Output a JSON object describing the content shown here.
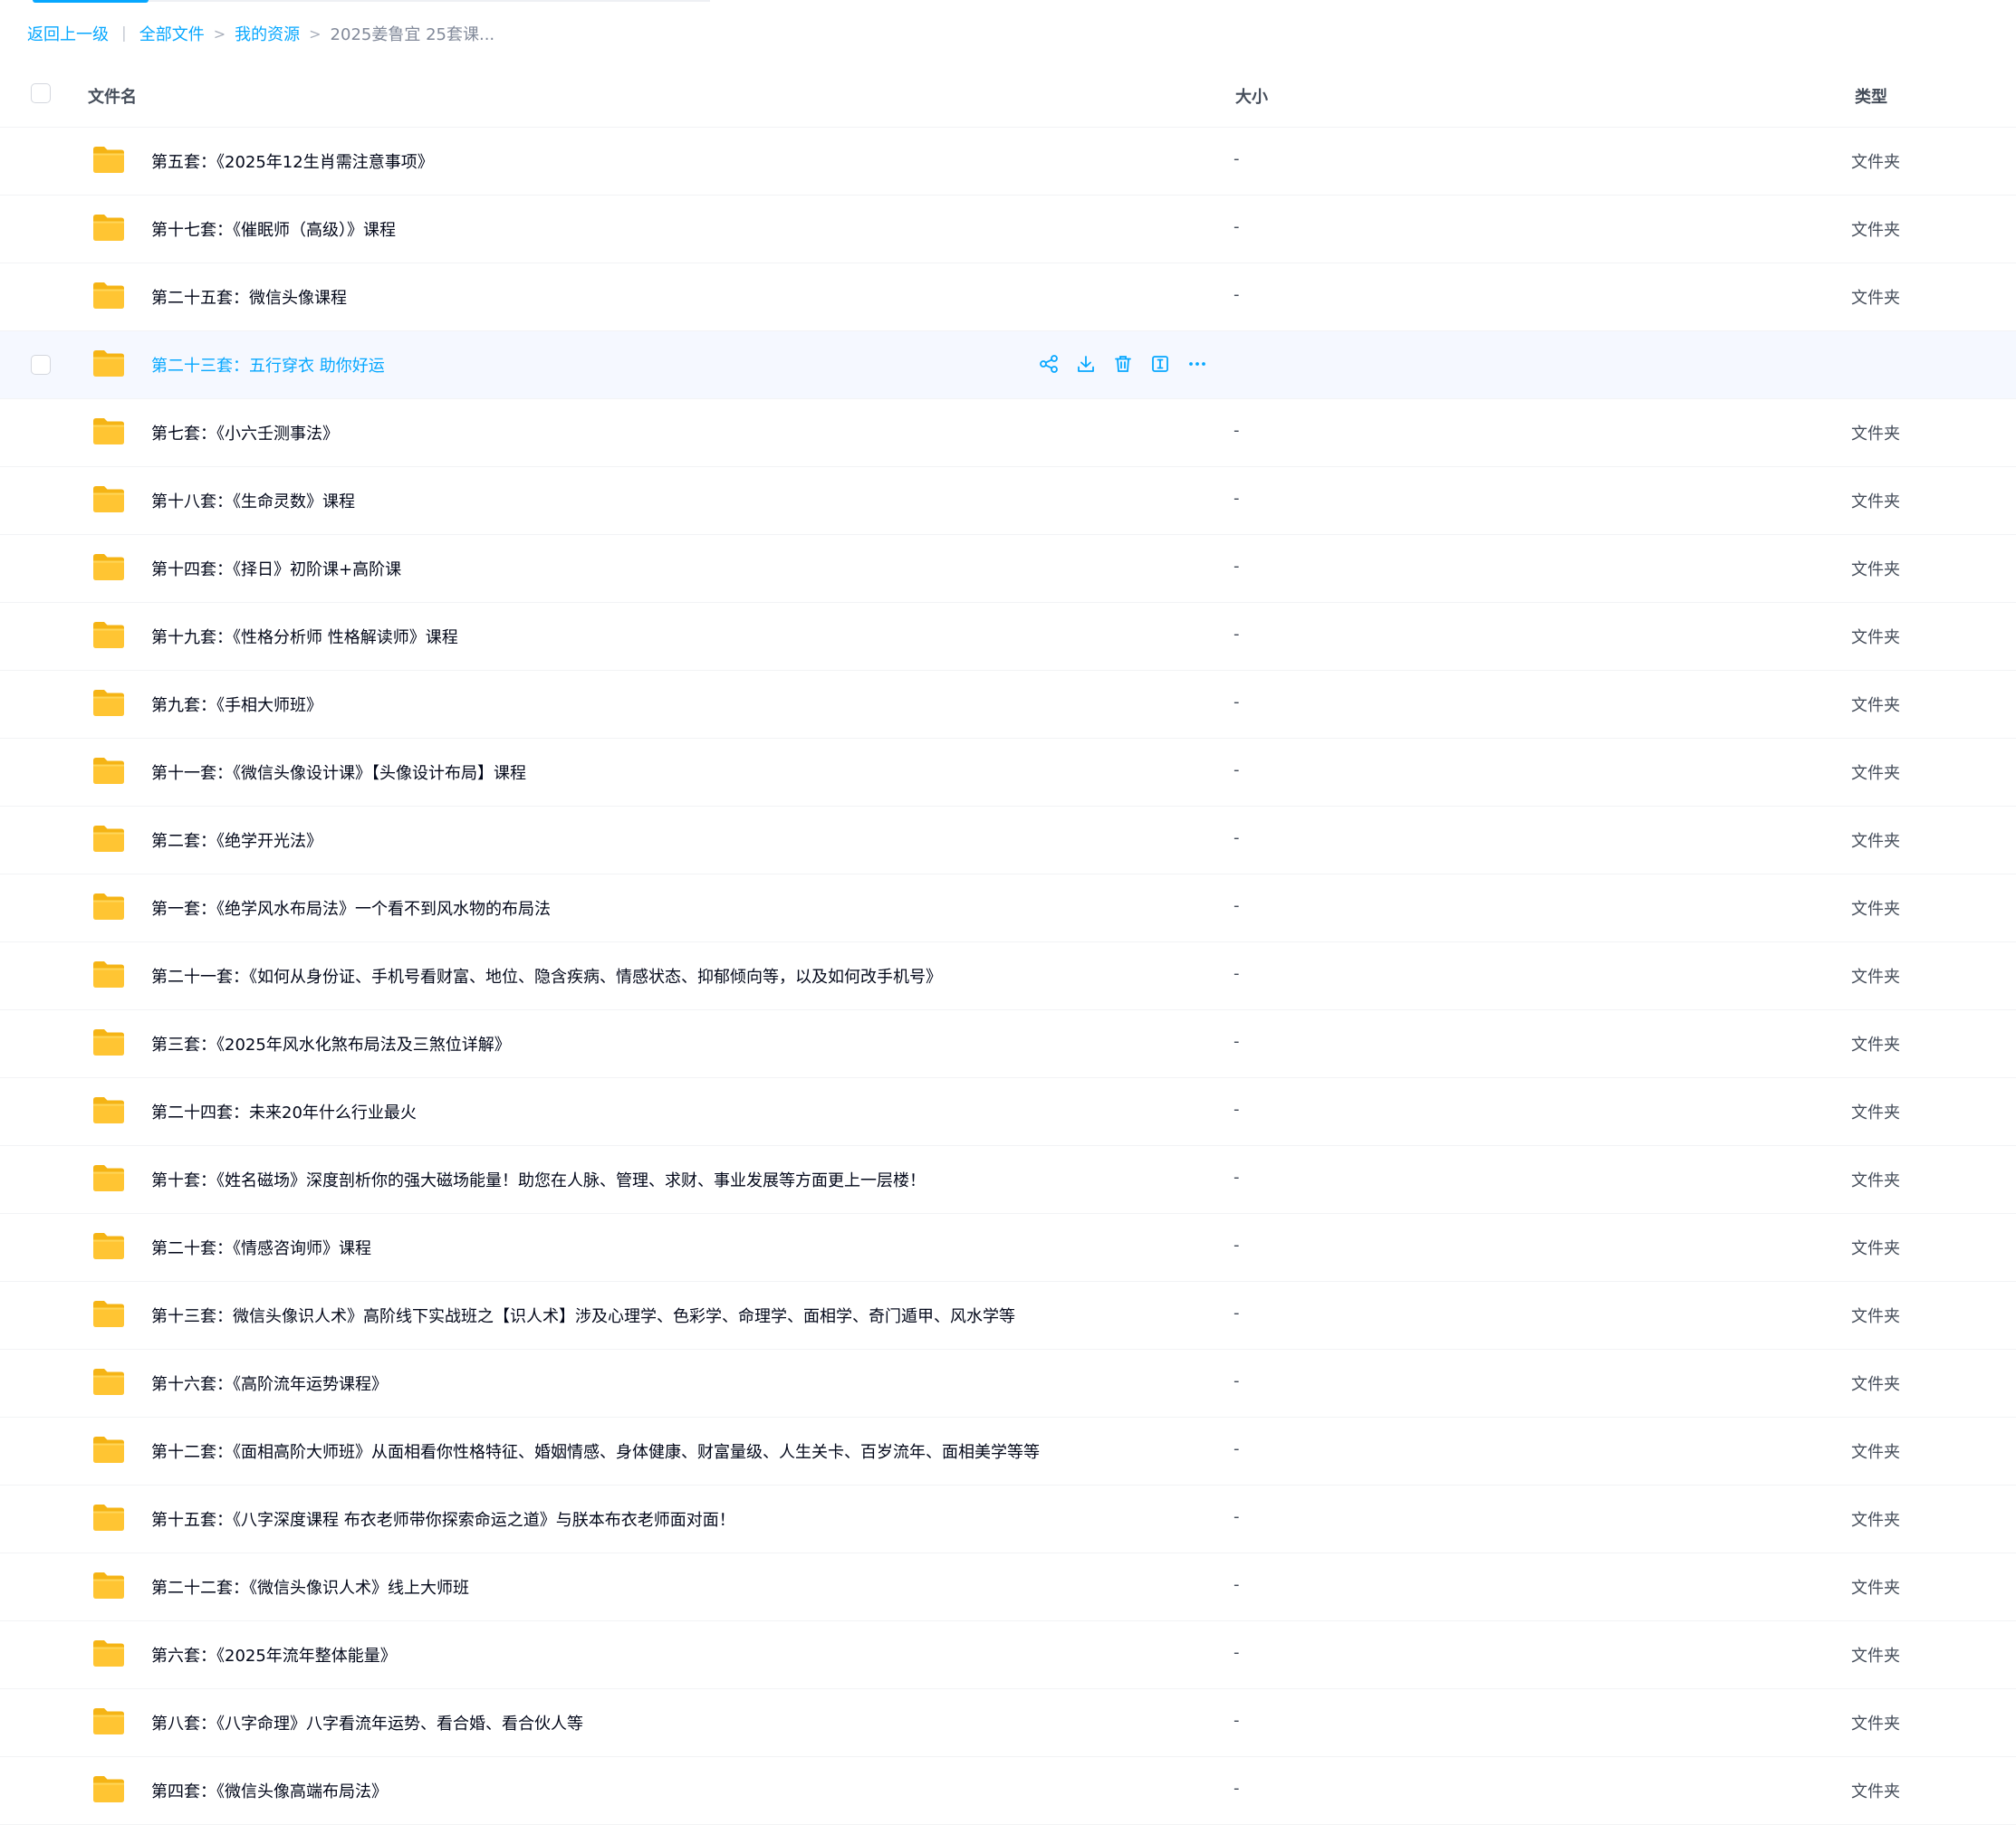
{
  "breadcrumb": {
    "back": "返回上一级",
    "divider": "|",
    "separator": ">",
    "items": [
      "全部文件",
      "我的资源"
    ],
    "current": "2025姜鲁宜 25套课..."
  },
  "columns": {
    "name": "文件名",
    "size": "大小",
    "type": "类型"
  },
  "icons": {
    "folder": "folder-icon",
    "share": "share-icon",
    "download": "download-icon",
    "delete": "trash-icon",
    "rename": "rename-icon",
    "more": "more-icon"
  },
  "colors": {
    "accent": "#06a7ff",
    "folder": "#ffc533",
    "hover_row": "#f5f8ff"
  },
  "rows": [
    {
      "name": "第五套：《2025年12生肖需注意事项》",
      "size": "-",
      "type": "文件夹"
    },
    {
      "name": "第十七套：《催眠师（高级）》课程",
      "size": "-",
      "type": "文件夹"
    },
    {
      "name": "第二十五套：微信头像课程",
      "size": "-",
      "type": "文件夹"
    },
    {
      "name": "第二十三套：五行穿衣 助你好运",
      "size": "",
      "type": "",
      "hover": true
    },
    {
      "name": "第七套：《小六壬测事法》",
      "size": "-",
      "type": "文件夹"
    },
    {
      "name": "第十八套：《生命灵数》课程",
      "size": "-",
      "type": "文件夹"
    },
    {
      "name": "第十四套：《择日》初阶课+高阶课",
      "size": "-",
      "type": "文件夹"
    },
    {
      "name": "第十九套：《性格分析师 性格解读师》课程",
      "size": "-",
      "type": "文件夹"
    },
    {
      "name": "第九套：《手相大师班》",
      "size": "-",
      "type": "文件夹"
    },
    {
      "name": "第十一套：《微信头像设计课》【头像设计布局】课程",
      "size": "-",
      "type": "文件夹"
    },
    {
      "name": "第二套：《绝学开光法》",
      "size": "-",
      "type": "文件夹"
    },
    {
      "name": "第一套：《绝学风水布局法》一个看不到风水物的布局法",
      "size": "-",
      "type": "文件夹"
    },
    {
      "name": "第二十一套：《如何从身份证、手机号看财富、地位、隐含疾病、情感状态、抑郁倾向等，以及如何改手机号》",
      "size": "-",
      "type": "文件夹"
    },
    {
      "name": "第三套：《2025年风水化煞布局法及三煞位详解》",
      "size": "-",
      "type": "文件夹"
    },
    {
      "name": "第二十四套：未来20年什么行业最火",
      "size": "-",
      "type": "文件夹"
    },
    {
      "name": "第十套：《姓名磁场》深度剖析你的强大磁场能量！助您在人脉、管理、求财、事业发展等方面更上一层楼！",
      "size": "-",
      "type": "文件夹"
    },
    {
      "name": "第二十套：《情感咨询师》课程",
      "size": "-",
      "type": "文件夹"
    },
    {
      "name": "第十三套：微信头像识人术》高阶线下实战班之【识人术】涉及心理学、色彩学、命理学、面相学、奇门遁甲、风水学等",
      "size": "-",
      "type": "文件夹"
    },
    {
      "name": "第十六套：《高阶流年运势课程》",
      "size": "-",
      "type": "文件夹"
    },
    {
      "name": "第十二套：《面相高阶大师班》从面相看你性格特征、婚姻情感、身体健康、财富量级、人生关卡、百岁流年、面相美学等等",
      "size": "-",
      "type": "文件夹"
    },
    {
      "name": "第十五套：《八字深度课程 布衣老师带你探索命运之道》与朕本布衣老师面对面！",
      "size": "-",
      "type": "文件夹"
    },
    {
      "name": "第二十二套：《微信头像识人术》线上大师班",
      "size": "-",
      "type": "文件夹"
    },
    {
      "name": "第六套：《2025年流年整体能量》",
      "size": "-",
      "type": "文件夹"
    },
    {
      "name": "第八套：《八字命理》八字看流年运势、看合婚、看合伙人等",
      "size": "-",
      "type": "文件夹"
    },
    {
      "name": "第四套：《微信头像高端布局法》",
      "size": "-",
      "type": "文件夹"
    }
  ]
}
